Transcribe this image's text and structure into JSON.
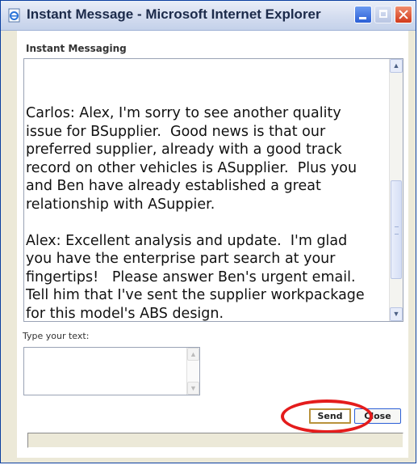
{
  "window": {
    "title": "Instant Message - Microsoft Internet Explorer"
  },
  "icons": {
    "app": "ie-page-icon",
    "minimize": "minimize-icon",
    "maximize": "maximize-icon",
    "close": "close-icon"
  },
  "chat": {
    "heading": "Instant Messaging",
    "transcript": "Carlos: Alex, I'm sorry to see another quality\nissue for BSupplier.  Good news is that our\npreferred supplier, already with a good track\nrecord on other vehicles is ASupplier.  Plus you\nand Ben have already established a great\nrelationship with ASuppier.\n\nAlex: Excellent analysis and update.  I'm glad\nyou have the enterprise part search at your\nfingertips!   Please answer Ben's urgent email.\nTell him that I've sent the supplier workpackage\nfor this model's ABS design."
  },
  "compose": {
    "label": "Type your text:",
    "value": ""
  },
  "buttons": {
    "send": "Send",
    "close": "Close"
  },
  "colors": {
    "highlight": "#e41c1c",
    "title_bar": "#c4d1ea",
    "close_button": "#d13a1c"
  }
}
